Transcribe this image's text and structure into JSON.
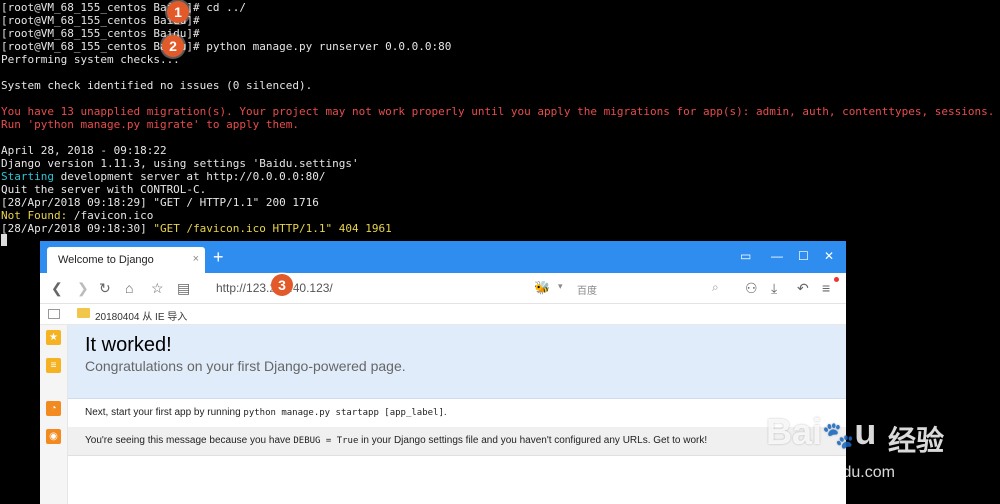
{
  "terminal": {
    "lines": [
      {
        "text": "[root@VM_68_155_centos Baidu]# cd ../",
        "color": "#e6e6e6"
      },
      {
        "text": "[root@VM_68_155_centos Baidu]#",
        "color": "#e6e6e6"
      },
      {
        "text": "[root@VM_68_155_centos Baidu]#",
        "color": "#e6e6e6"
      },
      {
        "text": "[root@VM_68_155_centos Baidu]# python manage.py runserver 0.0.0.0:80",
        "color": "#e6e6e6"
      },
      {
        "text": "Performing system checks...",
        "color": "#e6e6e6"
      },
      {
        "text": "",
        "color": "#e6e6e6"
      },
      {
        "text": "System check identified no issues (0 silenced).",
        "color": "#e6e6e6"
      },
      {
        "text": "",
        "color": "#e6e6e6"
      },
      {
        "text": "You have 13 unapplied migration(s). Your project may not work properly until you apply the migrations for app(s): admin, auth, contenttypes, sessions.",
        "color": "#e84c4c"
      },
      {
        "text": "Run 'python manage.py migrate' to apply them.",
        "color": "#e84c4c"
      },
      {
        "text": "",
        "color": "#e6e6e6"
      },
      {
        "text": "April 28, 2018 - 09:18:22",
        "color": "#e6e6e6"
      },
      {
        "text": "Django version 1.11.3, using settings 'Baidu.settings'",
        "color": "#e6e6e6"
      },
      {
        "segments": [
          {
            "text": "Starting",
            "color": "#29c6d6"
          },
          {
            "text": " development server at http://0.0.0.0:80/",
            "color": "#e6e6e6"
          }
        ]
      },
      {
        "text": "Quit the server with CONTROL-C.",
        "color": "#e6e6e6"
      },
      {
        "text": "[28/Apr/2018 09:18:29] \"GET / HTTP/1.1\" 200 1716",
        "color": "#e6e6e6"
      },
      {
        "segments": [
          {
            "text": "Not Found:",
            "color": "#e8d44c"
          },
          {
            "text": " /favicon.ico",
            "color": "#e6e6e6"
          }
        ]
      },
      {
        "segments": [
          {
            "text": "[28/Apr/2018 09:18:30] ",
            "color": "#e6e6e6"
          },
          {
            "text": "\"GET /favicon.ico HTTP/1.1\" 404 1961",
            "color": "#e8d44c"
          }
        ]
      }
    ]
  },
  "badges": [
    "1",
    "2",
    "3"
  ],
  "browser": {
    "tab_title": "Welcome to Django",
    "tab_close": "×",
    "new_tab": "+",
    "url": "http://123.207.40.123/",
    "search_placeholder": "百度",
    "bookmark": "20180404 从 IE 导入",
    "accent": "#2f8df0"
  },
  "page": {
    "heading": "It worked!",
    "subheading": "Congratulations on your first Django-powered page.",
    "next_prefix": "Next, start your first app by running ",
    "next_code": "python manage.py startapp [app_label]",
    "next_suffix": ".",
    "msg_prefix": "You're seeing this message because you have ",
    "msg_code": "DEBUG = True",
    "msg_suffix": " in your Django settings file and you haven't configured any URLs. Get to work!"
  },
  "watermark": {
    "logo": "Baidu",
    "cn": "经验",
    "url": "jingyan.baidu.com"
  }
}
